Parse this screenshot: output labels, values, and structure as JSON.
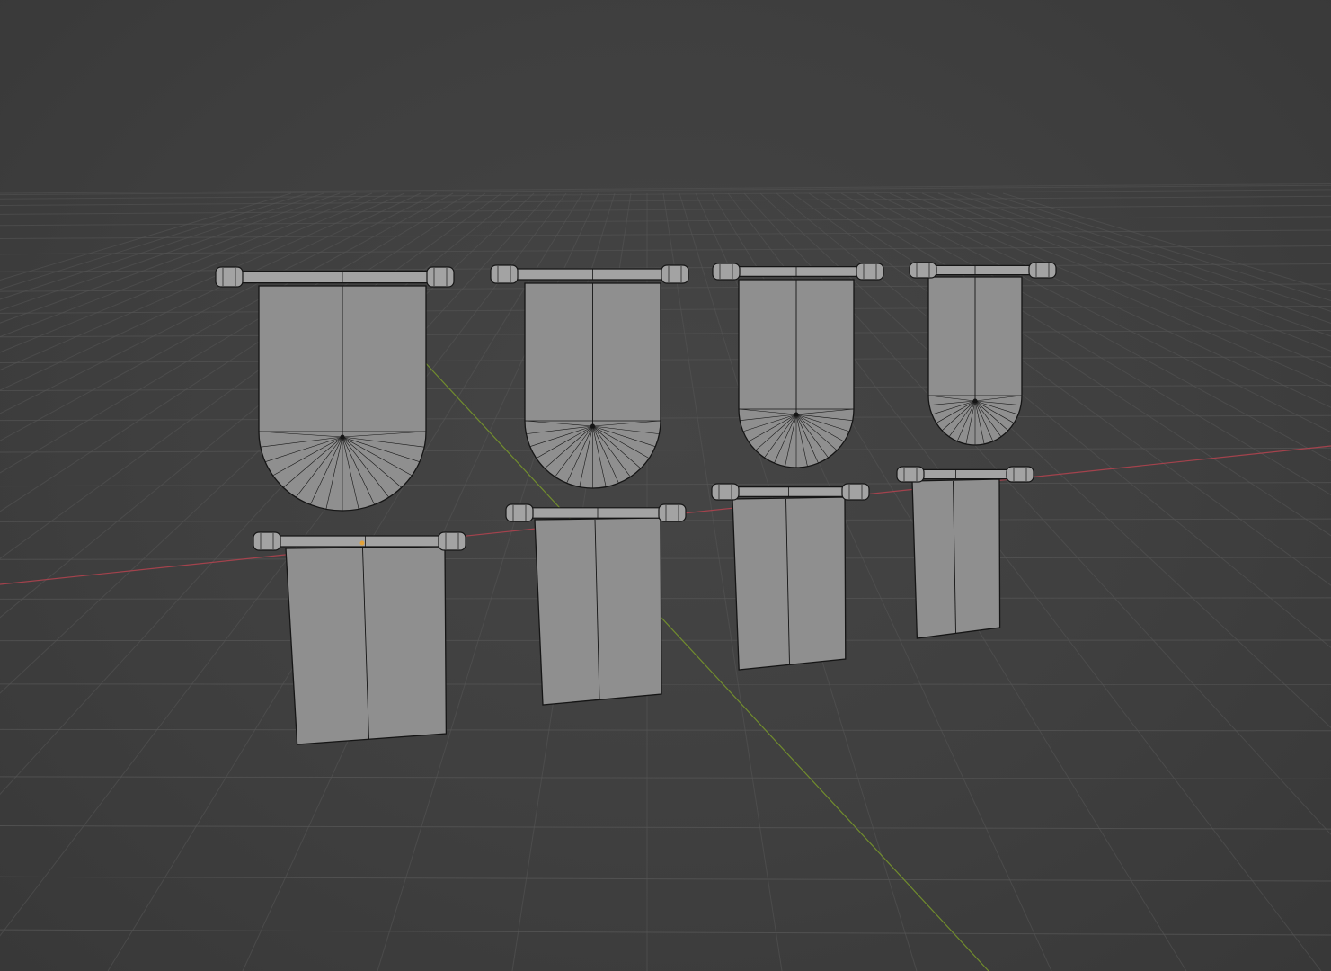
{
  "viewport": {
    "background": "#3f3f3f",
    "grid_color": "#555555",
    "x_axis_color": "#b5434f",
    "y_axis_color": "#7a9a2a"
  },
  "mesh": {
    "face_color": "#8f8f8f",
    "face_highlight": "#9a9a9a",
    "edge_color": "#151515",
    "rod_color": "#a3a3a3",
    "origin_color": "#e3a23a"
  },
  "banners": [
    {
      "id": "rounded-1",
      "shape": "rounded"
    },
    {
      "id": "rounded-2",
      "shape": "rounded"
    },
    {
      "id": "rounded-3",
      "shape": "rounded"
    },
    {
      "id": "rounded-4",
      "shape": "rounded"
    },
    {
      "id": "flat-1",
      "shape": "flat"
    },
    {
      "id": "flat-2",
      "shape": "flat"
    },
    {
      "id": "flat-3",
      "shape": "flat"
    },
    {
      "id": "flat-4",
      "shape": "flat"
    }
  ]
}
